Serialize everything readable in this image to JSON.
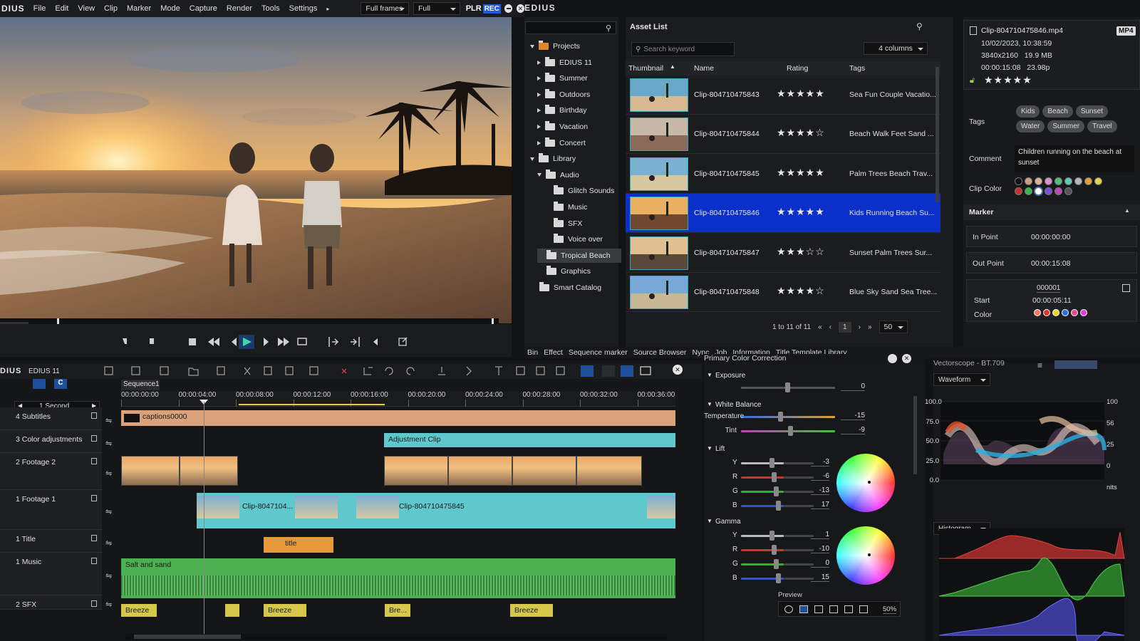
{
  "menu": {
    "brand": "DIUS",
    "items": [
      "File",
      "Edit",
      "View",
      "Clip",
      "Marker",
      "Mode",
      "Capture",
      "Render",
      "Tools",
      "Settings"
    ],
    "frames_select": "Full frames",
    "quality_select": "Full",
    "plr": "PLR",
    "rec": "REC",
    "app_name": "EDIUS"
  },
  "bin": {
    "search_placeholder": "",
    "items": [
      {
        "label": "Projects",
        "depth": 0
      },
      {
        "label": "EDIUS 11",
        "depth": 1
      },
      {
        "label": "Summer",
        "depth": 1
      },
      {
        "label": "Outdoors",
        "depth": 1
      },
      {
        "label": "Birthday",
        "depth": 1
      },
      {
        "label": "Vacation",
        "depth": 1
      },
      {
        "label": "Concert",
        "depth": 1
      },
      {
        "label": "Library",
        "depth": 0
      },
      {
        "label": "Audio",
        "depth": 1
      },
      {
        "label": "Glitch Sounds",
        "depth": 2
      },
      {
        "label": "Music",
        "depth": 2
      },
      {
        "label": "SFX",
        "depth": 2
      },
      {
        "label": "Voice over",
        "depth": 2
      },
      {
        "label": "Tropical Beach",
        "depth": 1
      },
      {
        "label": "Graphics",
        "depth": 1
      },
      {
        "label": "Smart Catalog",
        "depth": 0
      }
    ]
  },
  "assets": {
    "title": "Asset List",
    "search_placeholder": "Search keyword",
    "columns_select": "4 columns",
    "headers": [
      "Thumbnail",
      "Name",
      "Rating",
      "Tags"
    ],
    "rows": [
      {
        "name": "Clip-804710475843",
        "rating": 5,
        "tags": "Sea Fun Couple Vacatio..."
      },
      {
        "name": "Clip-804710475844",
        "rating": 4,
        "tags": "Beach Walk Feet Sand ..."
      },
      {
        "name": "Clip-804710475845",
        "rating": 5,
        "tags": "Palm Trees Beach Trav..."
      },
      {
        "name": "Clip-804710475846",
        "rating": 5,
        "tags": "Kids Running Beach Su..."
      },
      {
        "name": "Clip-804710475847",
        "rating": 3,
        "tags": "Sunset Palm Trees Sur..."
      },
      {
        "name": "Clip-804710475848",
        "rating": 4,
        "tags": "Blue Sky Sand Sea Tree..."
      }
    ],
    "pager_text": "1 to 11 of 11",
    "page": "1",
    "per_page": "50"
  },
  "details": {
    "filename": "Clip-804710475846.mp4",
    "badge": "MP4",
    "date": "10/02/2023, 10:38:59",
    "res_size": "3840x2160   19.9 MB",
    "duration_fps": "00:00:15:08   23.98p",
    "rating": 5,
    "tags_label": "Tags",
    "tags": [
      "Kids",
      "Beach",
      "Sunset",
      "Water",
      "Summer",
      "Travel"
    ],
    "comment_label": "Comment",
    "comment": "Children running on the beach at sunset",
    "clip_color_label": "Clip Color",
    "clip_colors": [
      "#111111",
      "#c9a17a",
      "#d9b3a0",
      "#e08ec7",
      "#52c07a",
      "#62c9b0",
      "#b7b7b7",
      "#e0a13a",
      "#e5d44a",
      "#c53030",
      "#3cb64a",
      "#ffffff",
      "#7b4fd6",
      "#c545b5",
      "#555555"
    ],
    "marker_label": "Marker",
    "in_label": "In Point",
    "in_value": "00:00:00:00",
    "out_label": "Out Point",
    "out_value": "00:00:15:08",
    "marker_name": "000001",
    "start_label": "Start",
    "start_value": "00:00:05:11",
    "color_label": "Color",
    "marker_colors": [
      "#f07a6a",
      "#e53030",
      "#e8d22a",
      "#2a6de8",
      "#e04a8a",
      "#e03ae0"
    ]
  },
  "tabs": [
    "Bin",
    "Effect",
    "Sequence marker",
    "Source Browser",
    "Nync",
    "Job",
    "Information",
    "Title Template Library"
  ],
  "timeline": {
    "title": "DIUS",
    "project": "EDIUS 11",
    "sequence": "Sequence1",
    "scale": "1 Second",
    "timecodes": [
      "00:00:00:00",
      "00:00:04:00",
      "00:00:08:00",
      "00:00:12:00",
      "00:00:16:00",
      "00:00:20:00",
      "00:00:24:00",
      "00:00:28:00",
      "00:00:32:00",
      "00:00:36:00"
    ],
    "tracks": [
      "4 Subtitles",
      "3 Color adjustments",
      "2 Footage 2",
      "1 Footage 1",
      "1 Title",
      "1 Music",
      "2 SFX"
    ],
    "clips": {
      "captions": "captions0000",
      "adjustment": "Adjustment Clip",
      "footage1a": "Clip-8047104...",
      "footage1b": "Clip-804710475845",
      "title": "title",
      "music": "Salt and sand",
      "sfx": [
        "Breeze",
        "Breeze",
        "Bre...",
        "Breeze"
      ]
    }
  },
  "pcc": {
    "title": "Primary Color Correction",
    "exposure_label": "Exposure",
    "exposure_value": "0",
    "wb_label": "White Balance",
    "temperature_label": "Temperature",
    "temperature_value": "-15",
    "tint_label": "Tint",
    "tint_value": "-9",
    "lift_label": "Lift",
    "lift": [
      {
        "ch": "Y",
        "v": "-3"
      },
      {
        "ch": "R",
        "v": "-6"
      },
      {
        "ch": "G",
        "v": "-13"
      },
      {
        "ch": "B",
        "v": "17"
      }
    ],
    "gamma_label": "Gamma",
    "gamma": [
      {
        "ch": "Y",
        "v": "1"
      },
      {
        "ch": "R",
        "v": "-10"
      },
      {
        "ch": "G",
        "v": "0"
      },
      {
        "ch": "B",
        "v": "15"
      }
    ],
    "preview_label": "Preview",
    "zoom": "50%"
  },
  "scope": {
    "title": "Vectorscope - BT.709",
    "waveform_select": "Waveform",
    "histogram_select": "Histogram",
    "y_labels": [
      "100.0",
      "75.0",
      "50.0",
      "25.0",
      "0.0"
    ],
    "right_labels": [
      "100",
      "56",
      "25",
      "0",
      "nits"
    ]
  }
}
